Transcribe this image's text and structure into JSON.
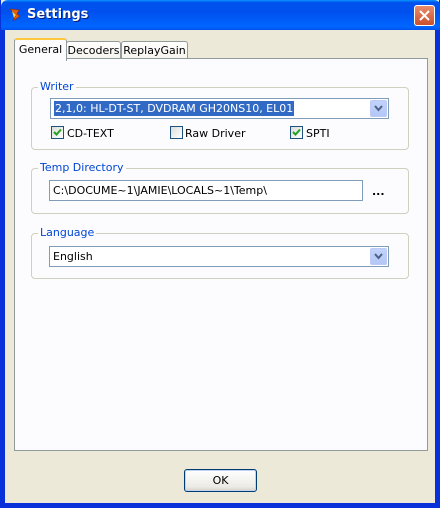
{
  "window": {
    "title": "Settings",
    "icon": "app-flame-icon"
  },
  "tabs": [
    {
      "label": "General",
      "active": true
    },
    {
      "label": "Decoders",
      "active": false
    },
    {
      "label": "ReplayGain",
      "active": false
    }
  ],
  "writer": {
    "group_label": "Writer",
    "drive_value": "2,1,0: HL-DT-ST, DVDRAM GH20NS10, EL01",
    "checkboxes": [
      {
        "label": "CD-TEXT",
        "checked": true
      },
      {
        "label": "Raw Driver",
        "checked": false
      },
      {
        "label": "SPTI",
        "checked": true
      }
    ]
  },
  "temp_directory": {
    "group_label": "Temp Directory",
    "path_value": "C:\\DOCUME~1\\JAMIE\\LOCALS~1\\Temp\\",
    "browse_label": "..."
  },
  "language": {
    "group_label": "Language",
    "selected": "English"
  },
  "buttons": {
    "ok_label": "OK"
  },
  "colors": {
    "titlebar": "#0053ee",
    "group_label": "#0046d5",
    "selection": "#316ac5",
    "checkmark": "#21a121"
  }
}
